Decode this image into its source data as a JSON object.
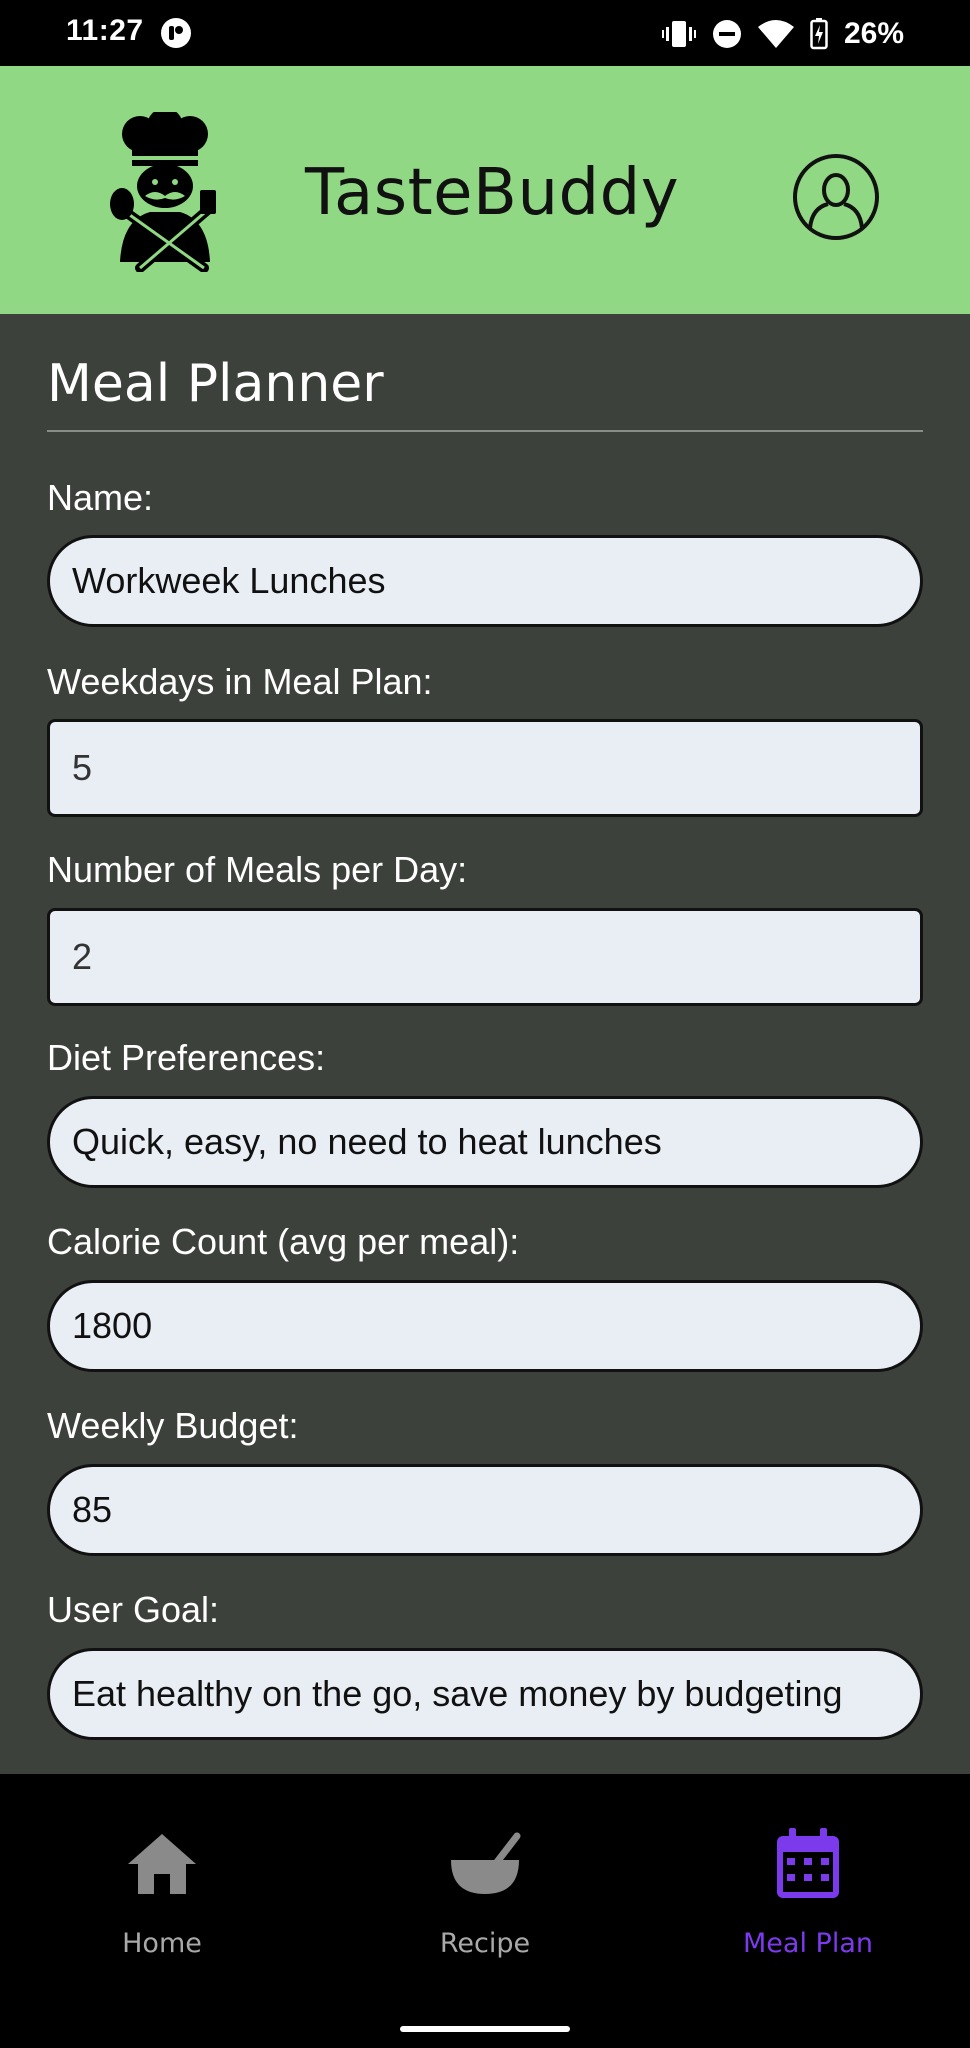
{
  "status_bar": {
    "time": "11:27",
    "battery": "26%"
  },
  "header": {
    "app_title": "TasteBuddy"
  },
  "page": {
    "title": "Meal Planner"
  },
  "form": {
    "name": {
      "label": "Name:",
      "value": "Workweek Lunches"
    },
    "weekdays": {
      "label": "Weekdays in Meal Plan:",
      "value": "5"
    },
    "meals_per_day": {
      "label": "Number of Meals per Day:",
      "value": "2"
    },
    "diet_preferences": {
      "label": "Diet Preferences:",
      "value": "Quick, easy, no need to heat lunches"
    },
    "calorie_count": {
      "label": "Calorie Count (avg per meal):",
      "value": "1800"
    },
    "weekly_budget": {
      "label": "Weekly Budget:",
      "value": "85"
    },
    "user_goal": {
      "label": "User Goal:",
      "value": "Eat healthy on the go, save money by budgeting"
    }
  },
  "bottom_nav": {
    "items": [
      {
        "label": "Home",
        "icon": "home-icon",
        "active": false
      },
      {
        "label": "Recipe",
        "icon": "bowl-icon",
        "active": false
      },
      {
        "label": "Meal Plan",
        "icon": "calendar-icon",
        "active": true
      }
    ]
  },
  "colors": {
    "header_bg": "#90d883",
    "main_bg": "#3d413c",
    "field_bg": "#e8eef4",
    "nav_active": "#7c3aed",
    "nav_inactive": "#a9a9a9"
  }
}
